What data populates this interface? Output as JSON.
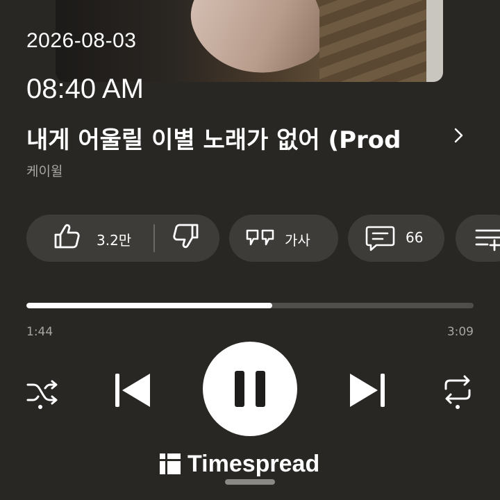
{
  "overlay": {
    "date": "2026-08-03",
    "time": "08:40 AM"
  },
  "track": {
    "title": "내게 어울릴 이별 노래가 없어 (Prod",
    "artist": "케이윌"
  },
  "actions": {
    "like_count": "3.2만",
    "lyrics_label": "가사",
    "comment_count": "66"
  },
  "playback": {
    "elapsed": "1:44",
    "total": "3:09",
    "progress_fraction": 0.55,
    "state": "playing"
  },
  "brand": {
    "name": "Timespread"
  },
  "colors": {
    "background": "#282724",
    "pill": "#3d3c39",
    "text_secondary": "#a8a7a3",
    "progress_fill": "#ffffff",
    "progress_track": "#4f4e4b"
  },
  "icons": [
    "thumbs-up-icon",
    "thumbs-down-icon",
    "lyrics-icon",
    "comment-icon",
    "queue-icon",
    "shuffle-icon",
    "previous-icon",
    "pause-icon",
    "next-icon",
    "repeat-icon",
    "chevron-right-icon",
    "timespread-logo-icon"
  ]
}
